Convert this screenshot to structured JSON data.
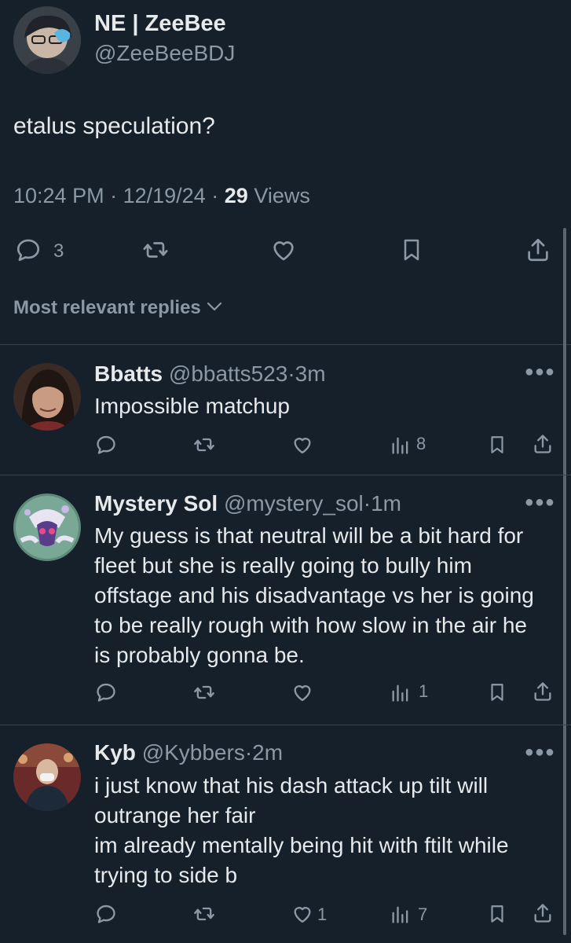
{
  "post": {
    "author_name": "NE | ZeeBee",
    "author_handle": "@ZeeBeeBDJ",
    "text": "etalus speculation?",
    "time": "10:24 PM",
    "date": "12/19/24",
    "views_count": "29",
    "views_label": "Views",
    "reply_count": "3",
    "sep": "·"
  },
  "sort": {
    "label": "Most relevant replies"
  },
  "replies": [
    {
      "name": "Bbatts",
      "handle": "@bbatts523",
      "age": "3m",
      "text": "Impossible matchup",
      "likes": "",
      "views": "8"
    },
    {
      "name": "Mystery Sol",
      "handle": "@mystery_sol",
      "age": "1m",
      "text": "My guess is that neutral will be a bit hard for\nfleet but she is really going to bully him\noffstage and his disadvantage vs her is going\nto be really rough with how slow in the air he\nis probably gonna be.",
      "likes": "",
      "views": "1"
    },
    {
      "name": "Kyb",
      "handle": "@Kybbers",
      "age": "2m",
      "text": "i just know that his dash attack up tilt will\noutrange her fair\nim already mentally being hit with ftilt while\ntrying to side b",
      "likes": "1",
      "views": "7"
    }
  ],
  "icons": {
    "reply": "reply-bubble-icon",
    "retweet": "retweet-icon",
    "like": "heart-icon",
    "views": "views-bar-chart-icon",
    "bookmark": "bookmark-icon",
    "share": "share-icon",
    "more": "more-dots-icon",
    "chevron": "chevron-down-icon"
  },
  "colors": {
    "background": "#15202b",
    "text": "#e7e9ea",
    "muted": "#8b98a5",
    "divider": "#38444d"
  }
}
